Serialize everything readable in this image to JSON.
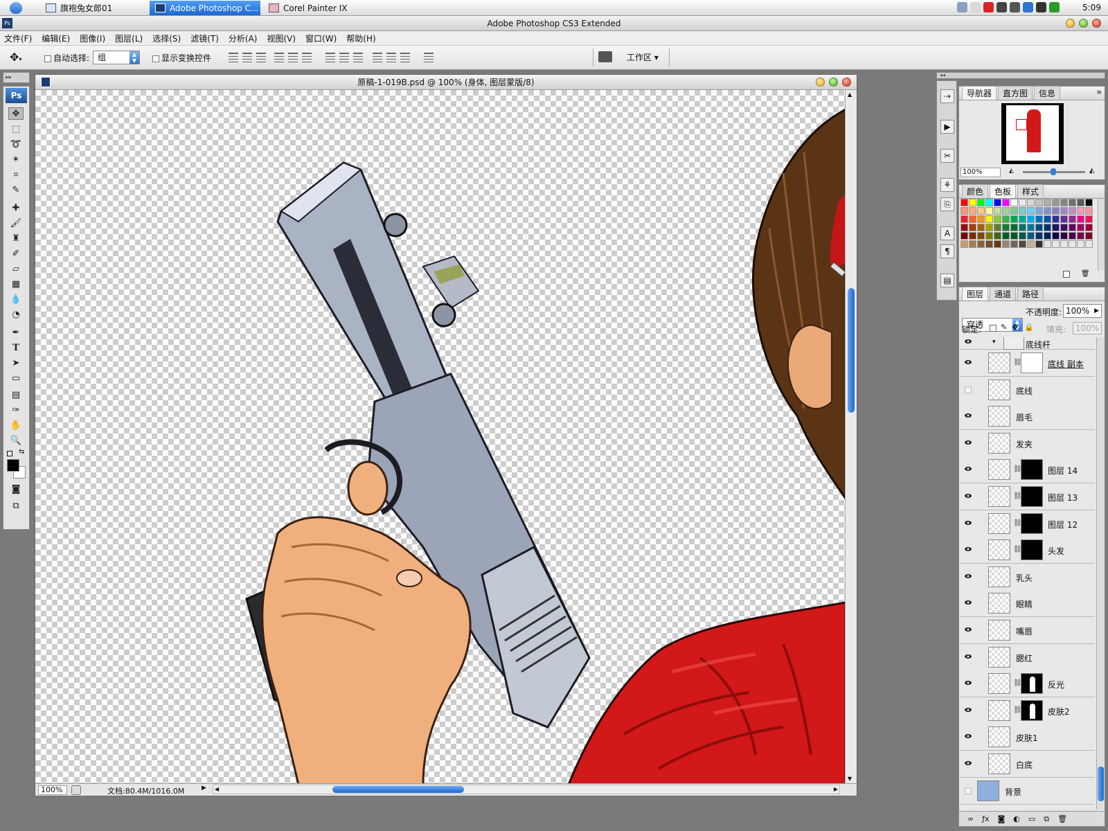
{
  "taskbar": {
    "items": [
      {
        "label": "旗袍兔女郎01",
        "icon": "folder-icon",
        "active": false
      },
      {
        "label": "Adobe Photoshop C...",
        "icon": "photoshop-icon",
        "active": true
      },
      {
        "label": "Corel Painter IX",
        "icon": "painter-icon",
        "active": false
      }
    ],
    "clock": "5:09"
  },
  "app": {
    "title": "Adobe Photoshop CS3 Extended"
  },
  "menu": [
    "文件(F)",
    "编辑(E)",
    "图像(I)",
    "图层(L)",
    "选择(S)",
    "滤镜(T)",
    "分析(A)",
    "视图(V)",
    "窗口(W)",
    "帮助(H)"
  ],
  "options": {
    "auto_select_label": "自动选择:",
    "auto_select_value": "组",
    "show_transform_label": "显示变换控件",
    "workspace_label": "工作区 ▾"
  },
  "document": {
    "title": "原稿-1-019B.psd @ 100% (身体, 图层蒙版/8)",
    "zoom": "100%",
    "doc_size": "文档:80.4M/1016.0M"
  },
  "navigator": {
    "tabs": [
      "导航器",
      "直方图",
      "信息"
    ],
    "zoom": "100%"
  },
  "swatches": {
    "tabs": [
      "颜色",
      "色板",
      "样式"
    ],
    "colors": [
      "#ff0000",
      "#ffff00",
      "#00ff00",
      "#00ffff",
      "#0000ff",
      "#ff00ff",
      "#ffffff",
      "#ebebeb",
      "#d6d6d6",
      "#c2c2c2",
      "#adadad",
      "#999999",
      "#858585",
      "#707070",
      "#5c5c5c",
      "#000000",
      "#f7977a",
      "#f9ad81",
      "#fdc68a",
      "#fff79a",
      "#c4df9b",
      "#a2d39c",
      "#82ca9d",
      "#7bcdc8",
      "#6ecff6",
      "#7ea7d8",
      "#8493ca",
      "#8882be",
      "#a187be",
      "#bc8dbf",
      "#f49ac2",
      "#f6989d",
      "#ed1c24",
      "#f26522",
      "#f7941d",
      "#fff200",
      "#8dc63f",
      "#39b54a",
      "#00a651",
      "#00a99d",
      "#00aeef",
      "#0072bc",
      "#0054a6",
      "#2e3192",
      "#662d91",
      "#92278f",
      "#ec008c",
      "#ed145b",
      "#9e0b0f",
      "#a0410d",
      "#a36209",
      "#aba000",
      "#598527",
      "#197b30",
      "#007236",
      "#00746b",
      "#0076a3",
      "#004a80",
      "#003471",
      "#1b1464",
      "#440e62",
      "#630460",
      "#9e005d",
      "#9e0039",
      "#790000",
      "#7b2e00",
      "#7d4900",
      "#827b00",
      "#406618",
      "#005e20",
      "#005826",
      "#005952",
      "#005b7f",
      "#003663",
      "#002157",
      "#0d004c",
      "#32004b",
      "#4b0049",
      "#7b0046",
      "#7a0026",
      "#c69c6d",
      "#a67c52",
      "#8c6239",
      "#754c24",
      "#603913",
      "#998675",
      "#736357",
      "#534741",
      "#c7b299",
      "#362f2d",
      "#e8e8e8",
      "#e8e8e8",
      "#e8e8e8",
      "#e8e8e8",
      "#e8e8e8",
      "#e8e8e8"
    ]
  },
  "layers": {
    "tabs": [
      "图层",
      "通道",
      "路径"
    ],
    "blend_mode": "穿透",
    "opacity_label": "不透明度:",
    "opacity": "100%",
    "lock_label": "锁定:",
    "fill_label": "填充:",
    "fill": "100%",
    "group_partial_label": "底线杆",
    "rows": [
      {
        "name": "底线 副本",
        "visible": true,
        "mask": "white"
      },
      {
        "name": "底线",
        "visible": false,
        "mask": ""
      },
      {
        "name": "眉毛",
        "visible": true,
        "mask": ""
      },
      {
        "name": "发夹",
        "visible": true,
        "mask": ""
      },
      {
        "name": "图层 14",
        "visible": true,
        "mask": "black"
      },
      {
        "name": "图层 13",
        "visible": true,
        "mask": "black"
      },
      {
        "name": "图层 12",
        "visible": true,
        "mask": "black"
      },
      {
        "name": "头发",
        "visible": true,
        "mask": "black"
      },
      {
        "name": "乳头",
        "visible": true,
        "mask": ""
      },
      {
        "name": "眼睛",
        "visible": true,
        "mask": ""
      },
      {
        "name": "嘴唇",
        "visible": true,
        "mask": ""
      },
      {
        "name": "腮红",
        "visible": true,
        "mask": ""
      },
      {
        "name": "反光",
        "visible": true,
        "mask": "figure"
      },
      {
        "name": "皮肤2",
        "visible": true,
        "mask": "figure"
      },
      {
        "name": "皮肤1",
        "visible": true,
        "mask": ""
      },
      {
        "name": "白底",
        "visible": true,
        "mask": ""
      },
      {
        "name": "背景",
        "visible": false,
        "mask": "",
        "background": true
      }
    ]
  },
  "colors": {
    "accent": "#2f74d0",
    "dress_red": "#d21818",
    "hair_brown": "#5a3414",
    "skin": "#f0b07e"
  }
}
